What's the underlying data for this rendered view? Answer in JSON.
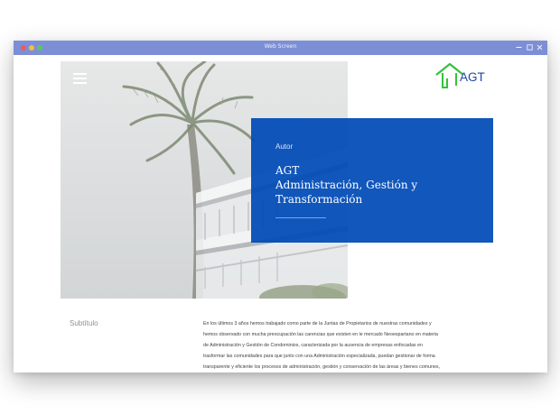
{
  "window": {
    "title": "Web Screen",
    "controls": [
      "minimize-icon",
      "maximize-icon",
      "close-icon"
    ]
  },
  "header": {
    "menu_icon": "hamburger-menu-icon",
    "logo_text": "AGT"
  },
  "hero": {
    "kicker": "Autor",
    "title_lines": [
      "AGT",
      "Administración, Gestión y",
      "Transformación"
    ]
  },
  "content": {
    "subtitle": "Subtítulo",
    "body_lines": [
      "En los últimos 3 años hemos trabajado como parte de la Juntas de Propietarios de nuestras comunidades y",
      "hemos observado con mucha preocupación las carencias que existen en le mercado Neoespartano en materia",
      "de  Administración y Gestión de Condominios, caracterizada por la ausencia de empresas enfocadas en",
      "trasformar las  comunidades para que junto con una Administración especializada,  puedan  gestionar de forma",
      "transparente y  eficiente los procesos de administración, gestión y conservación de las áreas y bienes comunes,"
    ]
  },
  "colors": {
    "titlebar": "#7c8fd6",
    "panel_blue": "#004ab6",
    "logo_green": "#35c23b",
    "logo_blue": "#1f47a8"
  }
}
